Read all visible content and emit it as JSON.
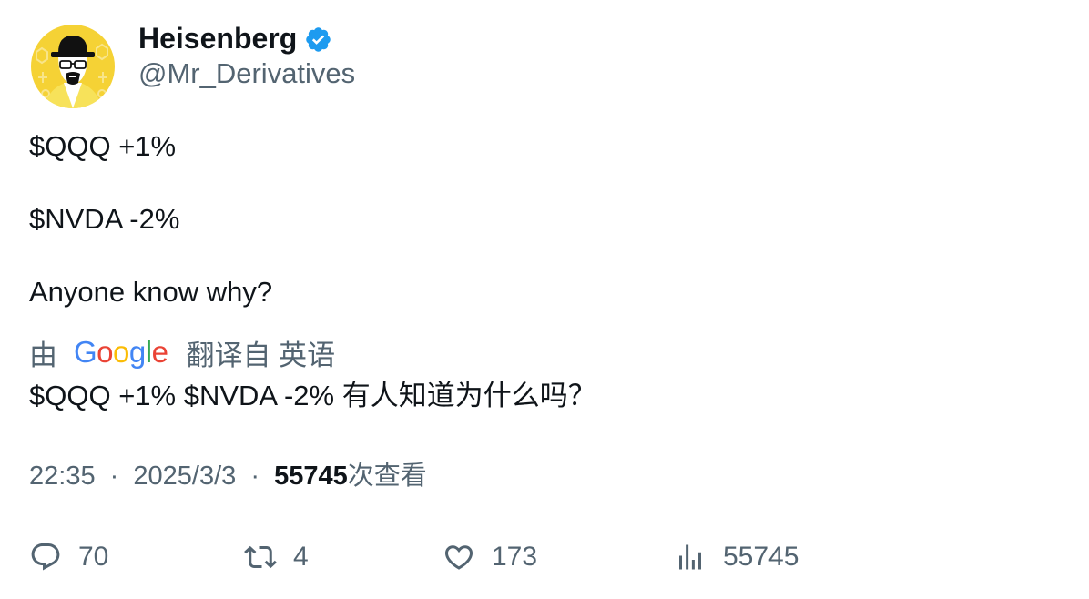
{
  "author": {
    "display_name": "Heisenberg",
    "handle": "@Mr_Derivatives",
    "verified": true,
    "avatar_icon": "heisenberg-avatar"
  },
  "tweet": {
    "lines": [
      "$QQQ +1%",
      "$NVDA -2%",
      "Anyone know why?"
    ]
  },
  "translation": {
    "prefix": "由",
    "provider": "Google",
    "suffix": "翻译自 英语",
    "text": "$QQQ +1% $NVDA -2% 有人知道为什么吗？"
  },
  "meta": {
    "time": "22:35",
    "separator": "·",
    "date": "2025/3/3",
    "views_count": "55745",
    "views_label": "次查看"
  },
  "actions": {
    "replies": "70",
    "retweets": "4",
    "likes": "173",
    "views": "55745"
  },
  "colors": {
    "text_primary": "#0f1419",
    "text_secondary": "#536471",
    "verified_blue": "#1d9bf0",
    "avatar_yellow": "#f5d235"
  }
}
